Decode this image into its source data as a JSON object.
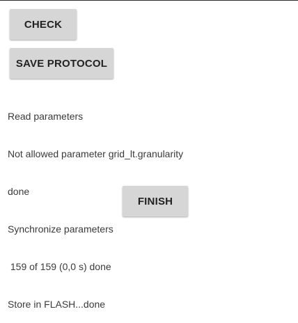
{
  "buttons": {
    "check_label": "CHECK",
    "save_protocol_label": "SAVE PROTOCOL",
    "finish_label": "FINISH"
  },
  "log_lines": [
    "Read parameters",
    "Not allowed parameter grid_lt.granularity",
    "done",
    "Synchronize parameters",
    " 159 of 159 (0,0 s) done",
    "Store in FLASH...done"
  ]
}
